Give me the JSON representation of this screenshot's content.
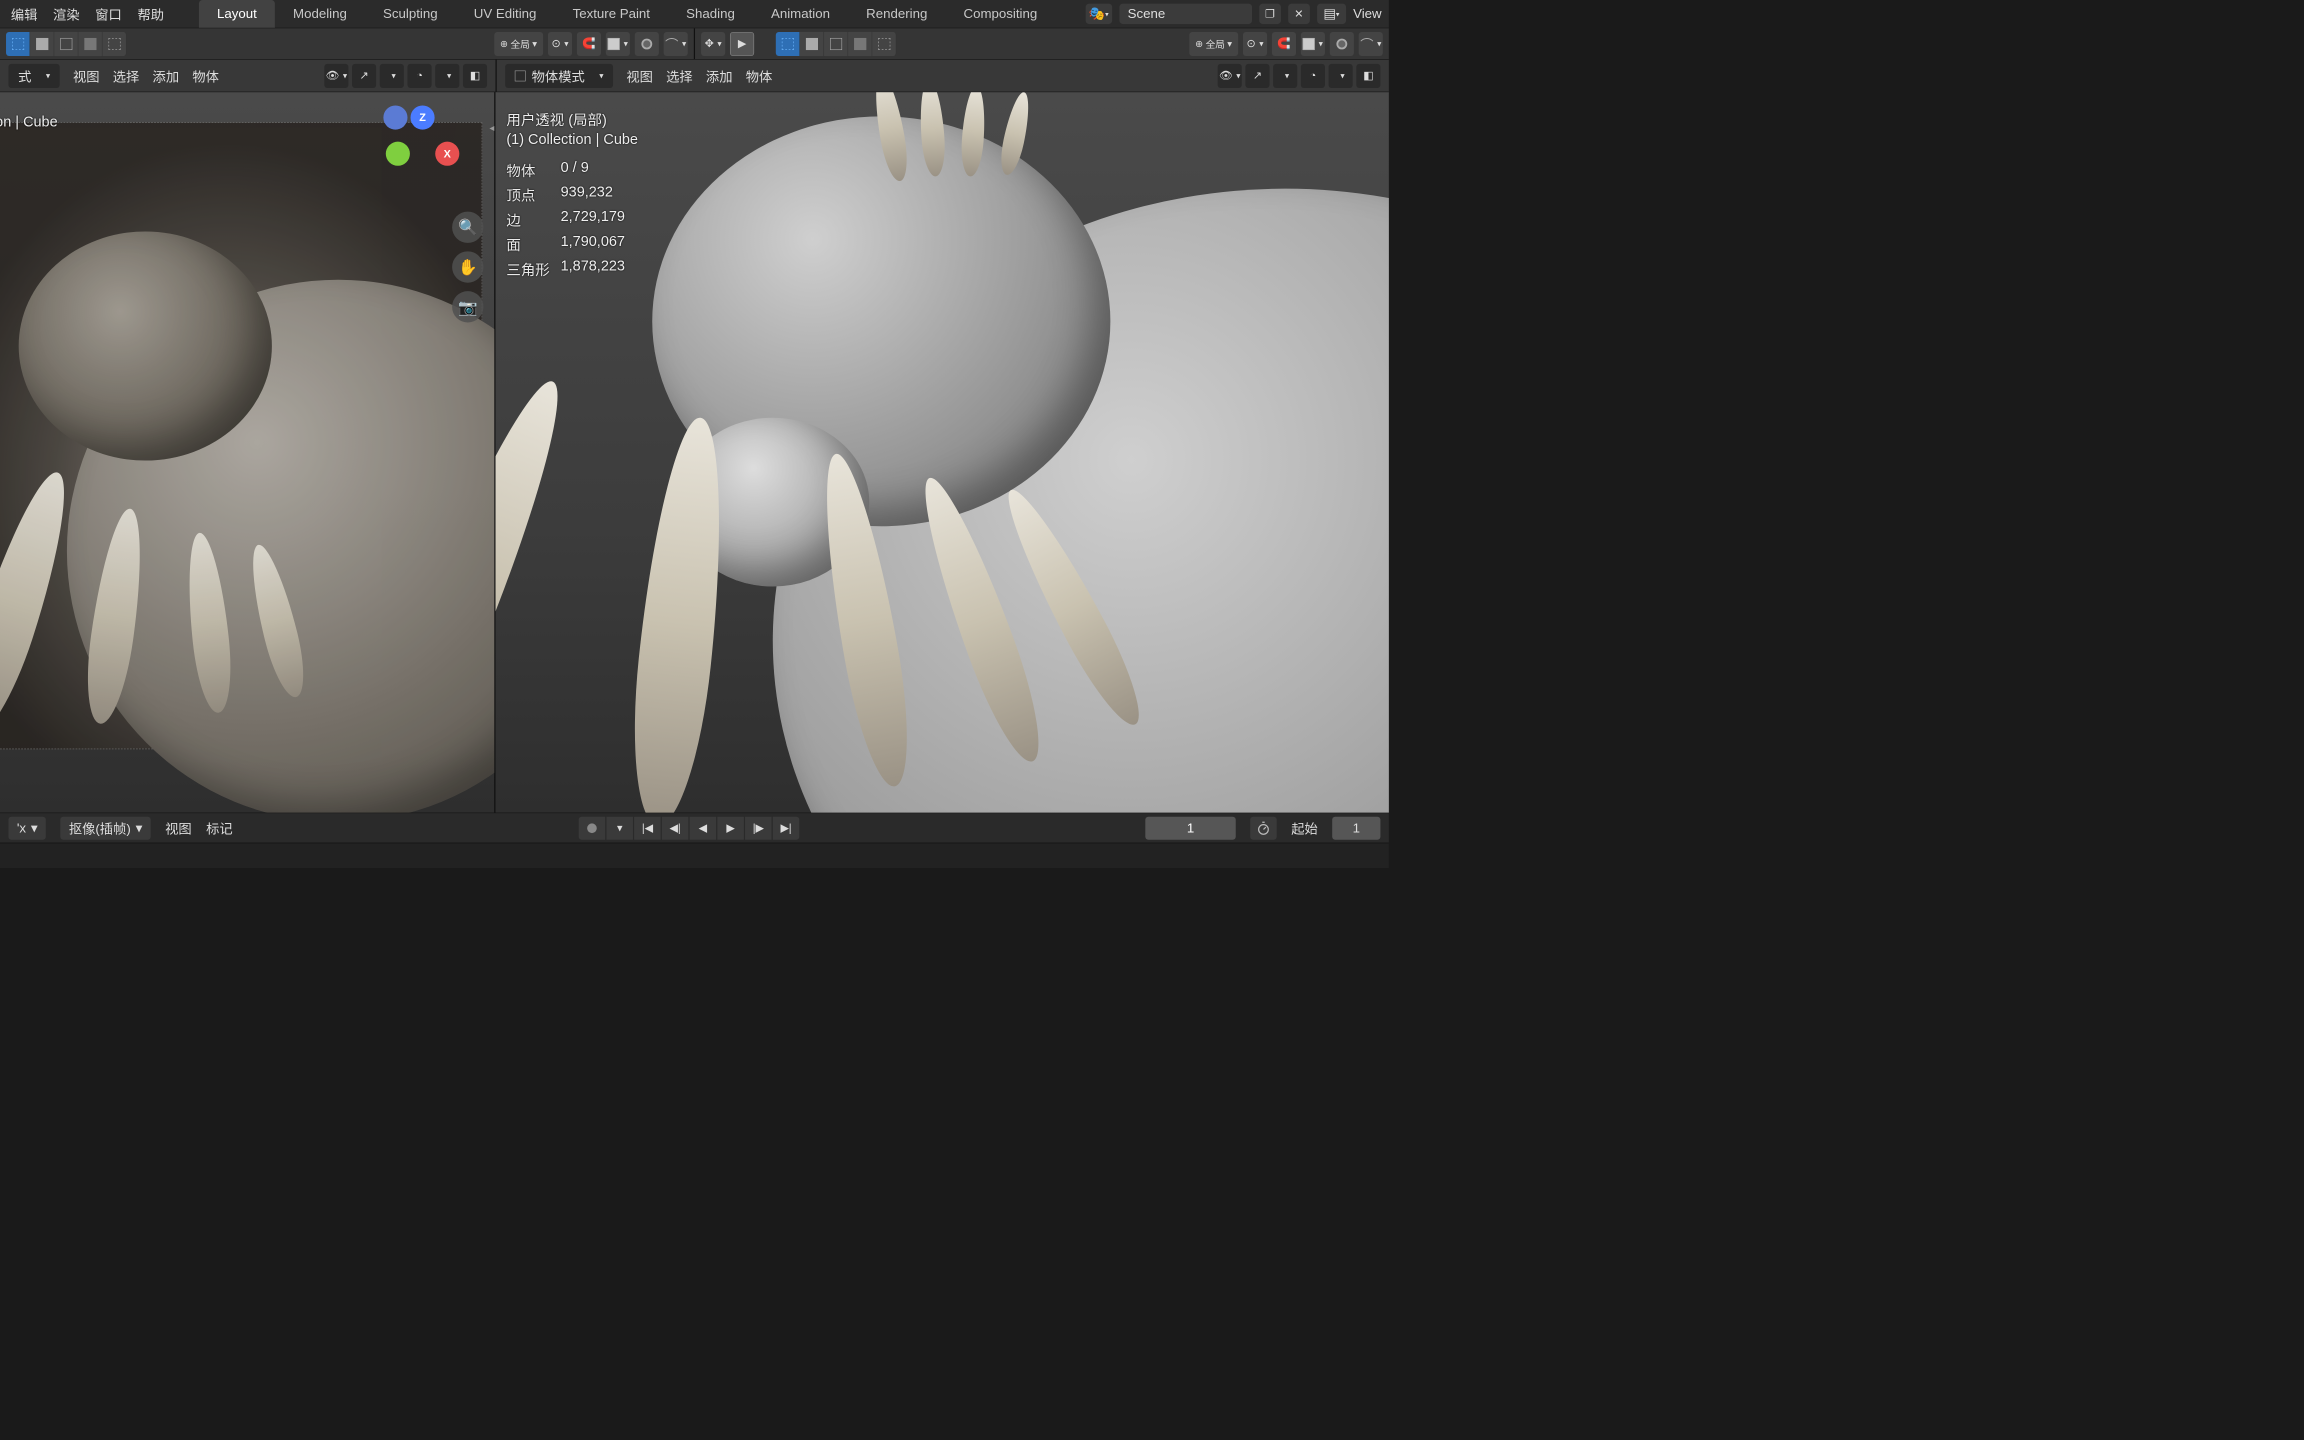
{
  "top_menu": {
    "edit": "编辑",
    "render": "渲染",
    "window": "窗口",
    "help": "帮助"
  },
  "workspaces": {
    "layout": "Layout",
    "modeling": "Modeling",
    "sculpting": "Sculpting",
    "uv": "UV Editing",
    "texpaint": "Texture Paint",
    "shading": "Shading",
    "animation": "Animation",
    "rendering": "Rendering",
    "compositing": "Compositing"
  },
  "scene": {
    "name": "Scene",
    "viewlayer": "View"
  },
  "toolbar": {
    "orient": "全局"
  },
  "header": {
    "mode": "物体模式",
    "view": "视图",
    "select": "选择",
    "add": "添加",
    "object": "物体",
    "left_dd": "式"
  },
  "left_overlay": {
    "collection": "on | Cube"
  },
  "right_overlay": {
    "title": "用户透视 (局部)",
    "subtitle": "(1) Collection | Cube",
    "stats": {
      "objects_label": "物体",
      "objects": "0 / 9",
      "verts_label": "顶点",
      "verts": "939,232",
      "edges_label": "边",
      "edges": "2,729,179",
      "faces_label": "面",
      "faces": "1,790,067",
      "tris_label": "三角形",
      "tris": "1,878,223"
    }
  },
  "gizmo": {
    "z": "Z",
    "y": "",
    "x": "X"
  },
  "timeline": {
    "dd1": "'x",
    "dd2": "抠像(插帧)",
    "view": "视图",
    "mark": "标记",
    "current_frame": "1",
    "start_label": "起始",
    "end": "1"
  }
}
